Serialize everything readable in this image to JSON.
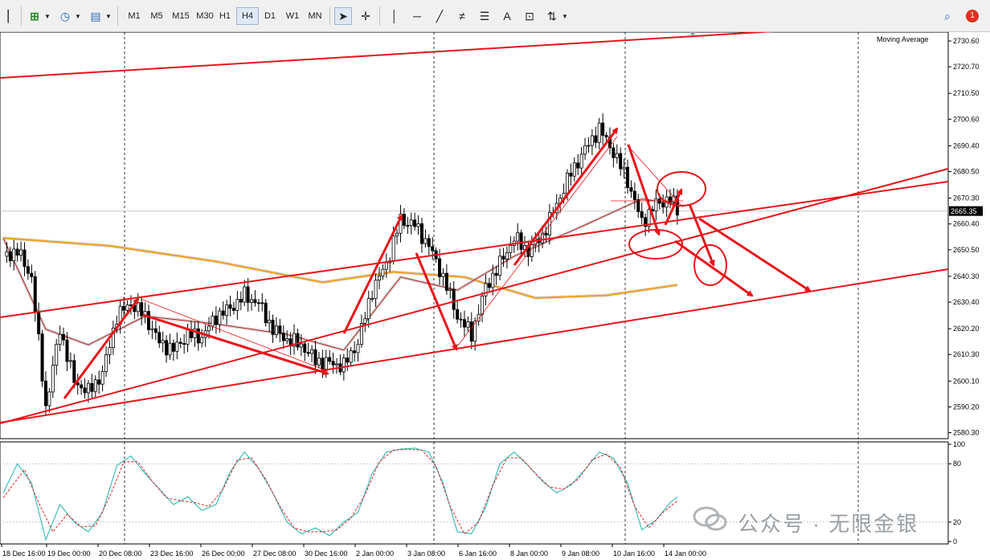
{
  "toolbar": {
    "timeframes": [
      "M1",
      "M5",
      "M15",
      "M30",
      "H1",
      "H4",
      "D1",
      "W1",
      "MN"
    ],
    "active_timeframe": "H4",
    "notification_count": "1"
  },
  "indicator_label": "Moving Average",
  "current_price": "2665.35",
  "price_ticks": [
    "2730.60",
    "2720.70",
    "2710.50",
    "2700.60",
    "2690.40",
    "2680.50",
    "2670.30",
    "2660.40",
    "2650.50",
    "2640.30",
    "2630.40",
    "2620.20",
    "2610.30",
    "2600.10",
    "2590.20",
    "2580.30"
  ],
  "osc_ticks": [
    "100",
    "80",
    "20",
    "0"
  ],
  "time_labels": [
    "18 Dec 16:00",
    "19 Dec 00:00",
    "20 Dec 08:00",
    "23 Dec 16:00",
    "26 Dec 00:00",
    "27 Dec 08:00",
    "30 Dec 16:00",
    "2 Jan 00:00",
    "3 Jan 08:00",
    "6 Jan 16:00",
    "8 Jan 00:00",
    "9 Jan 08:00",
    "10 Jan 16:00",
    "14 Jan 00:00"
  ],
  "watermark": "公众号 · 无限金银",
  "colors": {
    "annotation": "#e8141a",
    "ma_slow": "#f0a020",
    "ma_fast": "#b22222",
    "stoch_main": "#20b2aa",
    "stoch_signal": "#e02020",
    "candle": "#000000"
  },
  "chart_data": {
    "type": "candlestick",
    "ylim": [
      2578,
      2734
    ],
    "y_ticks": [
      2730.6,
      2720.7,
      2710.5,
      2700.6,
      2690.4,
      2680.5,
      2670.3,
      2660.4,
      2650.5,
      2640.3,
      2630.4,
      2620.2,
      2610.3,
      2600.1,
      2590.2,
      2580.3
    ],
    "current_price": 2665.35,
    "anchors": [
      [
        0,
        2648
      ],
      [
        4,
        2650
      ],
      [
        8,
        2640
      ],
      [
        12,
        2590
      ],
      [
        16,
        2620
      ],
      [
        20,
        2600
      ],
      [
        24,
        2596
      ],
      [
        28,
        2603
      ],
      [
        32,
        2625
      ],
      [
        36,
        2630
      ],
      [
        40,
        2625
      ],
      [
        44,
        2615
      ],
      [
        48,
        2612
      ],
      [
        52,
        2618
      ],
      [
        56,
        2617
      ],
      [
        60,
        2625
      ],
      [
        64,
        2628
      ],
      [
        68,
        2633
      ],
      [
        72,
        2630
      ],
      [
        76,
        2620
      ],
      [
        80,
        2616
      ],
      [
        84,
        2614
      ],
      [
        88,
        2608
      ],
      [
        92,
        2607
      ],
      [
        96,
        2606
      ],
      [
        100,
        2615
      ],
      [
        104,
        2635
      ],
      [
        108,
        2645
      ],
      [
        112,
        2662
      ],
      [
        116,
        2660
      ],
      [
        120,
        2652
      ],
      [
        124,
        2640
      ],
      [
        128,
        2625
      ],
      [
        132,
        2618
      ],
      [
        136,
        2636
      ],
      [
        140,
        2645
      ],
      [
        144,
        2655
      ],
      [
        148,
        2650
      ],
      [
        152,
        2656
      ],
      [
        156,
        2668
      ],
      [
        160,
        2680
      ],
      [
        164,
        2689
      ],
      [
        168,
        2697
      ],
      [
        172,
        2688
      ],
      [
        176,
        2677
      ],
      [
        180,
        2661
      ],
      [
        184,
        2668
      ],
      [
        188,
        2670
      ],
      [
        190,
        2666
      ]
    ],
    "moving_averages": [
      {
        "name": "MA slow",
        "values": [
          [
            0,
            2655
          ],
          [
            30,
            2652
          ],
          [
            60,
            2646
          ],
          [
            90,
            2638
          ],
          [
            110,
            2642
          ],
          [
            130,
            2640
          ],
          [
            150,
            2632
          ],
          [
            170,
            2633
          ],
          [
            190,
            2637
          ]
        ]
      },
      {
        "name": "MA fast",
        "values": [
          [
            0,
            2655
          ],
          [
            12,
            2620
          ],
          [
            24,
            2614
          ],
          [
            40,
            2625
          ],
          [
            60,
            2622
          ],
          [
            80,
            2618
          ],
          [
            96,
            2612
          ],
          [
            112,
            2640
          ],
          [
            128,
            2635
          ],
          [
            144,
            2648
          ],
          [
            164,
            2660
          ],
          [
            180,
            2670
          ],
          [
            190,
            2668
          ]
        ]
      }
    ],
    "stochastic": {
      "main": [
        [
          0,
          50
        ],
        [
          4,
          80
        ],
        [
          8,
          60
        ],
        [
          12,
          2
        ],
        [
          16,
          38
        ],
        [
          20,
          20
        ],
        [
          24,
          10
        ],
        [
          28,
          30
        ],
        [
          32,
          78
        ],
        [
          36,
          88
        ],
        [
          40,
          70
        ],
        [
          44,
          54
        ],
        [
          48,
          38
        ],
        [
          52,
          46
        ],
        [
          56,
          32
        ],
        [
          60,
          38
        ],
        [
          64,
          72
        ],
        [
          68,
          92
        ],
        [
          72,
          75
        ],
        [
          76,
          50
        ],
        [
          80,
          20
        ],
        [
          84,
          8
        ],
        [
          88,
          14
        ],
        [
          92,
          6
        ],
        [
          96,
          20
        ],
        [
          100,
          30
        ],
        [
          104,
          70
        ],
        [
          108,
          92
        ],
        [
          112,
          95
        ],
        [
          116,
          96
        ],
        [
          120,
          92
        ],
        [
          124,
          60
        ],
        [
          128,
          10
        ],
        [
          132,
          8
        ],
        [
          136,
          35
        ],
        [
          140,
          80
        ],
        [
          144,
          92
        ],
        [
          148,
          78
        ],
        [
          152,
          62
        ],
        [
          156,
          50
        ],
        [
          160,
          58
        ],
        [
          164,
          74
        ],
        [
          168,
          92
        ],
        [
          172,
          86
        ],
        [
          176,
          60
        ],
        [
          180,
          12
        ],
        [
          184,
          22
        ],
        [
          188,
          40
        ],
        [
          190,
          46
        ]
      ],
      "signal": [
        [
          0,
          45
        ],
        [
          6,
          74
        ],
        [
          10,
          40
        ],
        [
          14,
          10
        ],
        [
          18,
          28
        ],
        [
          22,
          15
        ],
        [
          26,
          16
        ],
        [
          30,
          46
        ],
        [
          34,
          82
        ],
        [
          38,
          82
        ],
        [
          42,
          62
        ],
        [
          46,
          45
        ],
        [
          50,
          42
        ],
        [
          54,
          40
        ],
        [
          58,
          36
        ],
        [
          62,
          54
        ],
        [
          66,
          84
        ],
        [
          70,
          86
        ],
        [
          74,
          64
        ],
        [
          78,
          36
        ],
        [
          82,
          14
        ],
        [
          86,
          10
        ],
        [
          90,
          10
        ],
        [
          94,
          12
        ],
        [
          98,
          24
        ],
        [
          102,
          48
        ],
        [
          106,
          82
        ],
        [
          110,
          94
        ],
        [
          114,
          95
        ],
        [
          118,
          94
        ],
        [
          122,
          78
        ],
        [
          126,
          36
        ],
        [
          130,
          8
        ],
        [
          134,
          20
        ],
        [
          138,
          58
        ],
        [
          142,
          86
        ],
        [
          146,
          86
        ],
        [
          150,
          70
        ],
        [
          154,
          56
        ],
        [
          158,
          54
        ],
        [
          162,
          64
        ],
        [
          166,
          84
        ],
        [
          170,
          90
        ],
        [
          174,
          76
        ],
        [
          178,
          36
        ],
        [
          182,
          14
        ],
        [
          186,
          30
        ],
        [
          190,
          42
        ]
      ]
    }
  }
}
